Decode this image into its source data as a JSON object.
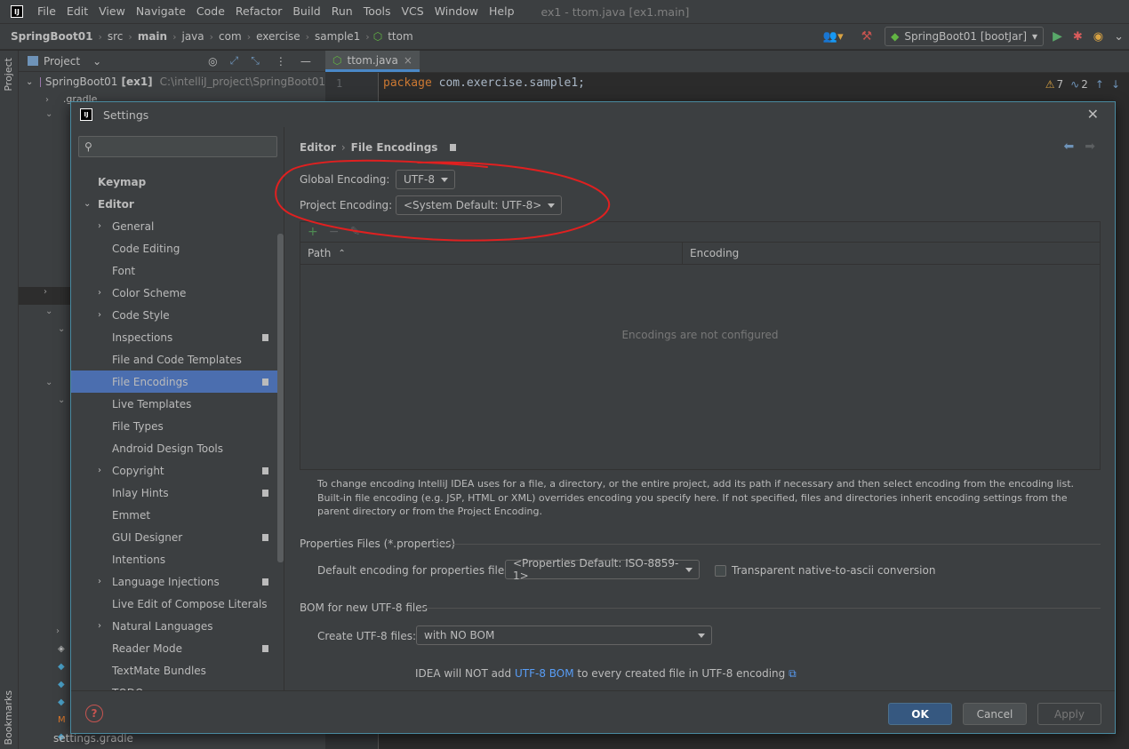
{
  "menubar": {
    "items": [
      "File",
      "Edit",
      "View",
      "Navigate",
      "Code",
      "Refactor",
      "Build",
      "Run",
      "Tools",
      "VCS",
      "Window",
      "Help"
    ],
    "window_title": "ex1 - ttom.java [ex1.main]"
  },
  "navbar": {
    "crumbs": [
      "SpringBoot01",
      "src",
      "main",
      "java",
      "com",
      "exercise",
      "sample1",
      "ttom"
    ],
    "run_config": "SpringBoot01 [bootJar]"
  },
  "left_stripe": {
    "project_tab": "Project",
    "bookmarks_tab": "Bookmarks"
  },
  "project_panel": {
    "header": "Project",
    "root_name": "SpringBoot01",
    "root_module": "[ex1]",
    "root_path": "C:\\intelliJ_project\\SpringBoot01",
    "partial_item": ".gradle",
    "last_item": "settings.gradle"
  },
  "editor": {
    "tab_label": "ttom.java",
    "line_number": "1",
    "code_keyword": "package",
    "code_rest": " com.exercise.sample1;",
    "warnings": "7",
    "weak_warnings": "2"
  },
  "dialog": {
    "title": "Settings",
    "search_placeholder": "",
    "sidebar": [
      {
        "label": "Keymap",
        "level": 0,
        "bold": true,
        "chevron": "",
        "bookmark": false
      },
      {
        "label": "Editor",
        "level": 0,
        "bold": true,
        "chevron": "down",
        "bookmark": false
      },
      {
        "label": "General",
        "level": 1,
        "chevron": "right",
        "bookmark": false
      },
      {
        "label": "Code Editing",
        "level": 1,
        "chevron": "",
        "bookmark": false
      },
      {
        "label": "Font",
        "level": 1,
        "chevron": "",
        "bookmark": false
      },
      {
        "label": "Color Scheme",
        "level": 1,
        "chevron": "right",
        "bookmark": false
      },
      {
        "label": "Code Style",
        "level": 1,
        "chevron": "right",
        "bookmark": false
      },
      {
        "label": "Inspections",
        "level": 1,
        "chevron": "",
        "bookmark": true
      },
      {
        "label": "File and Code Templates",
        "level": 1,
        "chevron": "",
        "bookmark": false
      },
      {
        "label": "File Encodings",
        "level": 1,
        "chevron": "",
        "bookmark": true,
        "selected": true
      },
      {
        "label": "Live Templates",
        "level": 1,
        "chevron": "",
        "bookmark": false
      },
      {
        "label": "File Types",
        "level": 1,
        "chevron": "",
        "bookmark": false
      },
      {
        "label": "Android Design Tools",
        "level": 1,
        "chevron": "",
        "bookmark": false
      },
      {
        "label": "Copyright",
        "level": 1,
        "chevron": "right",
        "bookmark": true
      },
      {
        "label": "Inlay Hints",
        "level": 1,
        "chevron": "",
        "bookmark": true
      },
      {
        "label": "Emmet",
        "level": 1,
        "chevron": "",
        "bookmark": false
      },
      {
        "label": "GUI Designer",
        "level": 1,
        "chevron": "",
        "bookmark": true
      },
      {
        "label": "Intentions",
        "level": 1,
        "chevron": "",
        "bookmark": false
      },
      {
        "label": "Language Injections",
        "level": 1,
        "chevron": "right",
        "bookmark": true
      },
      {
        "label": "Live Edit of Compose Literals",
        "level": 1,
        "chevron": "",
        "bookmark": false
      },
      {
        "label": "Natural Languages",
        "level": 1,
        "chevron": "right",
        "bookmark": false
      },
      {
        "label": "Reader Mode",
        "level": 1,
        "chevron": "",
        "bookmark": true
      },
      {
        "label": "TextMate Bundles",
        "level": 1,
        "chevron": "",
        "bookmark": false
      },
      {
        "label": "TODO",
        "level": 1,
        "chevron": "",
        "bookmark": false
      }
    ],
    "breadcrumb_parent": "Editor",
    "breadcrumb_current": "File Encodings",
    "global_encoding_label": "Global Encoding:",
    "global_encoding_value": "UTF-8",
    "project_encoding_label": "Project Encoding:",
    "project_encoding_value": "<System Default: UTF-8>",
    "table": {
      "col_path": "Path",
      "col_encoding": "Encoding",
      "empty_text": "Encodings are not configured"
    },
    "help_text": "To change encoding IntelliJ IDEA uses for a file, a directory, or the entire project, add its path if necessary and then select encoding from the encoding list. Built-in file encoding (e.g. JSP, HTML or XML) overrides encoding you specify here. If not specified, files and directories inherit encoding settings from the parent directory or from the Project Encoding.",
    "properties_section": "Properties Files (*.properties)",
    "properties_label": "Default encoding for properties files:",
    "properties_value": "<Properties Default: ISO-8859-1>",
    "native_ascii_label": "Transparent native-to-ascii conversion",
    "bom_section": "BOM for new UTF-8 files",
    "bom_label": "Create UTF-8 files:",
    "bom_value": "with NO BOM",
    "bom_note_before": "IDEA will NOT add ",
    "bom_note_link": "UTF-8 BOM",
    "bom_note_after": " to every created file in UTF-8 encoding",
    "buttons": {
      "ok": "OK",
      "cancel": "Cancel",
      "apply": "Apply"
    }
  },
  "colors": {
    "accent": "#4b6eaf",
    "annotation": "#e02020",
    "link": "#589df6"
  }
}
